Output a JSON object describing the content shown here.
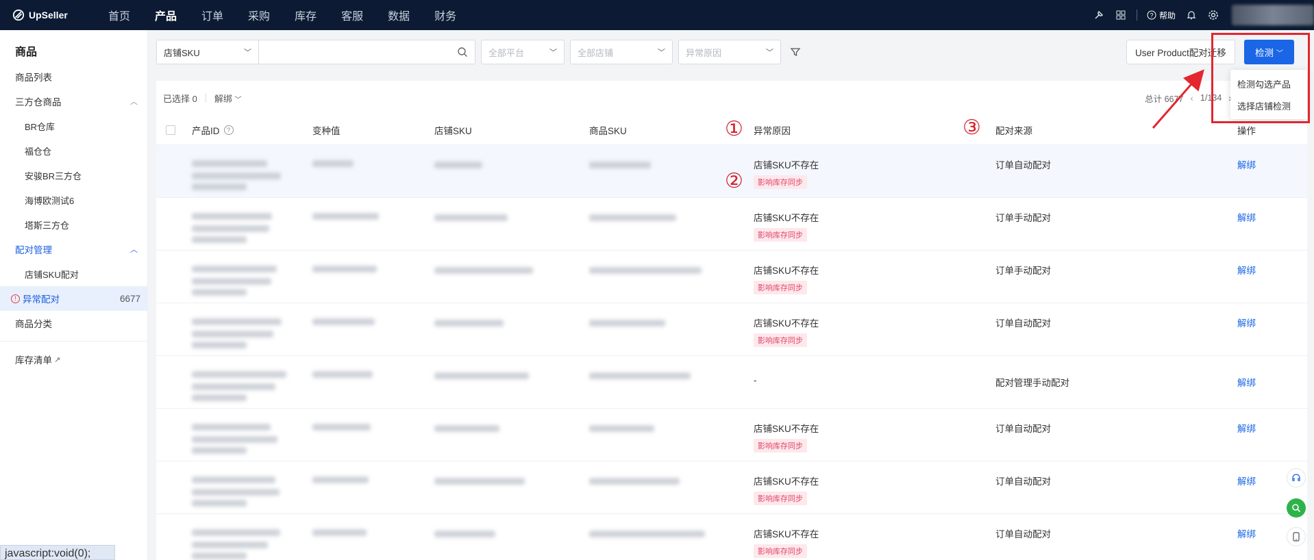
{
  "brand": "UpSeller",
  "nav": [
    {
      "label": "首页",
      "active": false
    },
    {
      "label": "产品",
      "active": true
    },
    {
      "label": "订单",
      "active": false
    },
    {
      "label": "采购",
      "active": false
    },
    {
      "label": "库存",
      "active": false
    },
    {
      "label": "客服",
      "active": false
    },
    {
      "label": "数据",
      "active": false
    },
    {
      "label": "财务",
      "active": false
    }
  ],
  "topbar": {
    "help_label": "帮助"
  },
  "sidebar": {
    "title": "商品",
    "items": [
      {
        "label": "商品列表"
      },
      {
        "label": "三方仓商品"
      },
      {
        "label": "BR仓库"
      },
      {
        "label": "福仓仓"
      },
      {
        "label": "安骏BR三方仓"
      },
      {
        "label": "海博欧测试6"
      },
      {
        "label": "塔斯三方仓"
      },
      {
        "label": "配对管理"
      },
      {
        "label": "店铺SKU配对"
      },
      {
        "label": "异常配对",
        "count": "6677"
      },
      {
        "label": "商品分类"
      },
      {
        "label": "库存清单"
      }
    ]
  },
  "status_bar": "javascript:void(0);",
  "filters": {
    "field_select": "店铺SKU",
    "search_placeholder": "",
    "platform_placeholder": "全部平台",
    "store_placeholder": "全部店铺",
    "reason_placeholder": "异常原因"
  },
  "buttons": {
    "migrate": "User Product配对迁移",
    "detect": "检测"
  },
  "detect_menu": [
    "检测勾选产品",
    "选择店铺检测"
  ],
  "toolbar": {
    "selected": "已选择 0",
    "unbind": "解绑",
    "total": "总计 6677",
    "page": "1/134"
  },
  "table": {
    "columns": [
      "产品ID",
      "变种值",
      "店铺SKU",
      "商品SKU",
      "异常原因",
      "配对来源",
      "操作"
    ],
    "annotations": [
      "①",
      "②",
      "③"
    ],
    "rows": [
      {
        "reason": "店铺SKU不存在",
        "tag": "影响库存同步",
        "source": "订单自动配对",
        "action": "解绑"
      },
      {
        "reason": "店铺SKU不存在",
        "tag": "影响库存同步",
        "source": "订单手动配对",
        "action": "解绑"
      },
      {
        "reason": "店铺SKU不存在",
        "tag": "影响库存同步",
        "source": "订单手动配对",
        "action": "解绑"
      },
      {
        "reason": "店铺SKU不存在",
        "tag": "影响库存同步",
        "source": "订单自动配对",
        "action": "解绑"
      },
      {
        "reason": "-",
        "tag": "",
        "source": "配对管理手动配对",
        "action": "解绑"
      },
      {
        "reason": "店铺SKU不存在",
        "tag": "影响库存同步",
        "source": "订单自动配对",
        "action": "解绑"
      },
      {
        "reason": "店铺SKU不存在",
        "tag": "影响库存同步",
        "source": "订单自动配对",
        "action": "解绑"
      },
      {
        "reason": "店铺SKU不存在",
        "tag": "影响库存同步",
        "source": "订单自动配对",
        "action": "解绑"
      }
    ]
  },
  "colors": {
    "nav_bg": "#0c1b33",
    "primary": "#1a66e6",
    "annotation_red": "#d4202c",
    "tag_bg": "#fde8ec",
    "tag_text": "#e2476a"
  }
}
